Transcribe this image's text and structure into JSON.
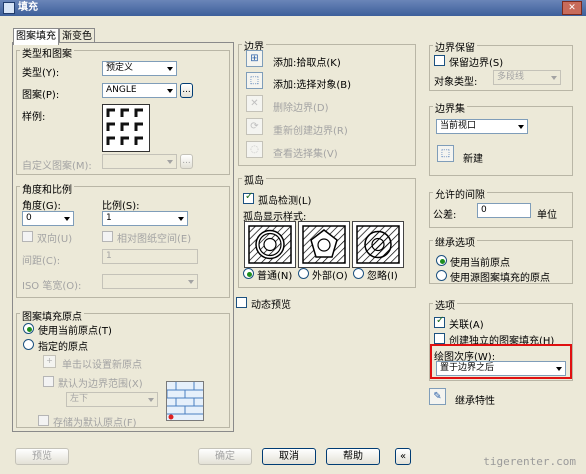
{
  "window": {
    "title": "填充",
    "close_glyph": "✕"
  },
  "tabs": [
    "图案填充",
    "渐变色"
  ],
  "type_pattern": {
    "group_title": "类型和图案",
    "type_label": "类型(Y):",
    "type_value": "预定义",
    "pattern_label": "图案(P):",
    "pattern_value": "ANGLE",
    "browse_label": "...",
    "sample_label": "样例:",
    "custom_label": "自定义图案(M):",
    "custom_value": ""
  },
  "angle_scale": {
    "group_title": "角度和比例",
    "angle_label": "角度(G):",
    "angle_value": "0",
    "scale_label": "比例(S):",
    "scale_value": "1",
    "double_label": "双向(U)",
    "relative_label": "相对图纸空间(E)",
    "spacing_label": "间距(C):",
    "spacing_value": "1",
    "iso_label": "ISO 笔宽(O):",
    "iso_value": ""
  },
  "origin": {
    "group_title": "图案填充原点",
    "use_current_label": "使用当前原点(T)",
    "specified_label": "指定的原点",
    "click_set_label": "单击以设置新原点",
    "default_boundary_label": "默认为边界范围(X)",
    "position_value": "左下",
    "store_default_label": "存储为默认原点(F)"
  },
  "boundaries": {
    "group_title": "边界",
    "add_pick_label": "添加:拾取点(K)",
    "add_select_label": "添加:选择对象(B)",
    "remove_label": "删除边界(D)",
    "recreate_label": "重新创建边界(R)",
    "view_selection_label": "查看选择集(V)"
  },
  "islands": {
    "group_title": "孤岛",
    "detect_label": "孤岛检测(L)",
    "display_style_label": "孤岛显示样式:",
    "normal_label": "普通(N)",
    "outer_label": "外部(O)",
    "ignore_label": "忽略(I)"
  },
  "preview_dynamic_label": "动态预览",
  "boundary_retention": {
    "group_title": "边界保留",
    "retain_label": "保留边界(S)",
    "object_type_label": "对象类型:",
    "object_type_value": "多段线"
  },
  "boundary_set": {
    "group_title": "边界集",
    "value": "当前视口",
    "new_label": "新建"
  },
  "gap": {
    "group_title": "允许的间隙",
    "tolerance_label": "公差:",
    "tolerance_value": "0",
    "unit_label": "单位"
  },
  "inherit_options": {
    "group_title": "继承选项",
    "use_current_label": "使用当前原点",
    "use_source_label": "使用源图案填充的原点"
  },
  "options": {
    "group_title": "选项",
    "associative_label": "关联(A)",
    "separate_label": "创建独立的图案填充(H)",
    "draw_order_label": "绘图次序(W):",
    "draw_order_value": "置于边界之后"
  },
  "inherit_properties_label": "继承特性",
  "footer": {
    "preview": "预览",
    "ok": "确定",
    "cancel": "取消",
    "help": "帮助",
    "collapse": "«"
  },
  "watermark": "tigerenter.com"
}
